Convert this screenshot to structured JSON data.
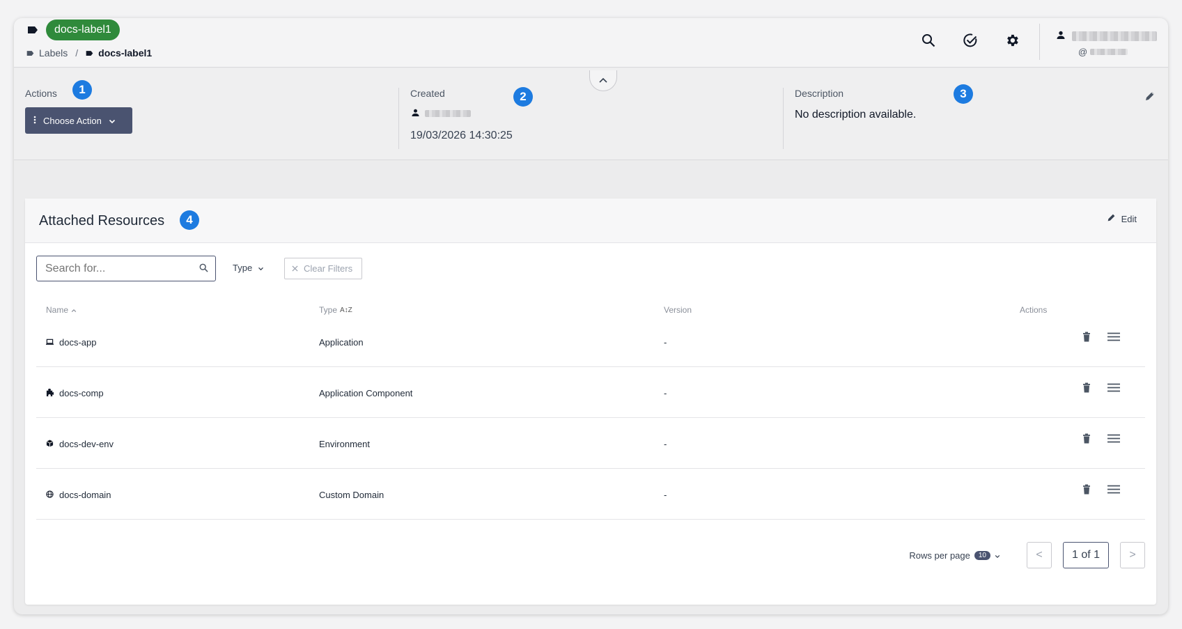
{
  "header": {
    "label_name": "docs-label1",
    "breadcrumb": {
      "root": "Labels",
      "separator": "/",
      "current": "docs-label1"
    },
    "user": {
      "at": "@"
    }
  },
  "info": {
    "actions_label": "Actions",
    "choose_action": "Choose Action",
    "created_label": "Created",
    "created_time": "19/03/2026 14:30:25",
    "description_label": "Description",
    "description_text": "No description available."
  },
  "annotations": [
    "1",
    "2",
    "3",
    "4"
  ],
  "resources": {
    "title": "Attached Resources",
    "edit_label": "Edit",
    "search_placeholder": "Search for...",
    "type_filter": "Type",
    "clear_filters": "Clear Filters",
    "columns": {
      "name": "Name",
      "type": "Type",
      "version": "Version",
      "actions": "Actions"
    },
    "rows": [
      {
        "name": "docs-app",
        "type": "Application",
        "version": "-",
        "icon": "laptop-icon"
      },
      {
        "name": "docs-comp",
        "type": "Application Component",
        "version": "-",
        "icon": "puzzle-icon"
      },
      {
        "name": "docs-dev-env",
        "type": "Environment",
        "version": "-",
        "icon": "cube-icon"
      },
      {
        "name": "docs-domain",
        "type": "Custom Domain",
        "version": "-",
        "icon": "globe-icon"
      }
    ],
    "pagination": {
      "rows_per_page_label": "Rows per page",
      "rows_per_page": "10",
      "page": "1 of 1",
      "prev": "<",
      "next": ">"
    }
  },
  "colors": {
    "label_green": "#2f8a3b",
    "primary": "#4a5370",
    "badge_blue": "#1d7be0"
  }
}
